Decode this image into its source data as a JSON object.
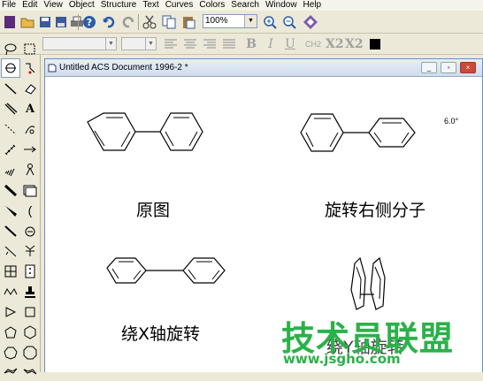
{
  "menu": [
    "File",
    "Edit",
    "View",
    "Object",
    "Structure",
    "Text",
    "Curves",
    "Colors",
    "Search",
    "Window",
    "Help"
  ],
  "toolbar": {
    "zoom_value": "100%",
    "icons": [
      "new-icon",
      "open-icon",
      "save-icon",
      "save-as-icon",
      "print-icon",
      "help-icon",
      "undo-icon",
      "redo-icon",
      "cut-icon",
      "copy-icon",
      "paste-icon",
      "zoom-in-icon",
      "zoom-out-icon",
      "show-hide-icon"
    ]
  },
  "format": {
    "bold": "B",
    "italic": "I",
    "underline": "U",
    "formula": "CH2",
    "subscript": "X2",
    "superscript": "X2"
  },
  "document": {
    "title": "Untitled ACS Document 1996-2 *",
    "minimize": "_",
    "restore": "▫",
    "close": "×"
  },
  "canvas": {
    "angle_label": "6.0°",
    "label_original": "原图",
    "label_rotate_right": "旋转右侧分子",
    "label_rotate_x": "绕X轴旋转",
    "label_rotate_y": "绕Y轴旋转"
  },
  "watermark": {
    "text": "技术员联盟",
    "url": "www.jsgho.com"
  },
  "colors": {
    "watermark": "#2bb14a",
    "accent": "#7f9db9"
  }
}
